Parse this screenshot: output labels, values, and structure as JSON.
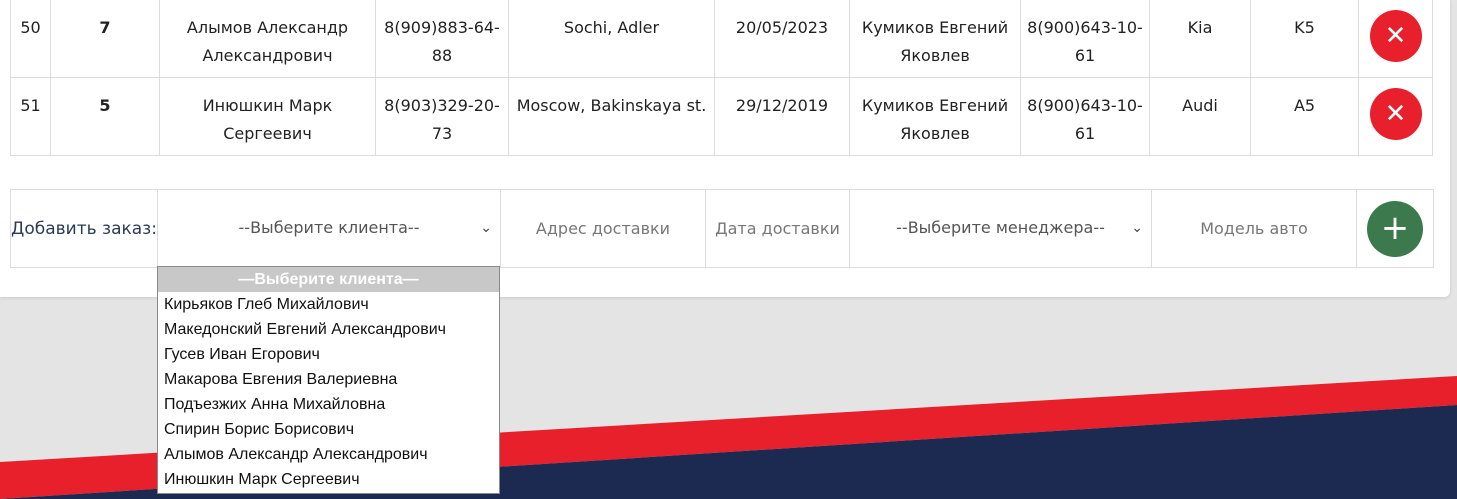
{
  "orders": [
    {
      "id": "50",
      "num": "7",
      "client": "Алымов Александр Александрович",
      "phone": "8(909)883-64-88",
      "address": "Sochi, Adler",
      "date": "20/05/2023",
      "manager": "Кумиков Евгений Яковлев",
      "manager_phone": "8(900)643-10-61",
      "brand": "Kia",
      "model": "K5",
      "delete_icon": "✕"
    },
    {
      "id": "51",
      "num": "5",
      "client": "Инюшкин Марк Сергеевич",
      "phone": "8(903)329-20-73",
      "address": "Moscow, Bakinskaya st.",
      "date": "29/12/2019",
      "manager": "Кумиков Евгений Яковлев",
      "manager_phone": "8(900)643-10-61",
      "brand": "Audi",
      "model": "A5",
      "delete_icon": "✕"
    }
  ],
  "add_form": {
    "label": "Добавить заказ:",
    "client_select": "--Выберите клиента--",
    "address_placeholder": "Адрес доставки",
    "date_placeholder": "Дата доставки",
    "manager_select": "--Выберите менеджера--",
    "model_placeholder": "Модель авто",
    "chevron": "⌄",
    "add_icon": "+"
  },
  "client_dropdown": {
    "selected": "—Выберите клиента—",
    "options": [
      "Кирьяков Глеб Михайлович",
      "Македонский Евгений Александрович",
      "Гусев Иван Егорович",
      "Макарова Евгения Валериевна",
      "Подъезжих Анна Михайловна",
      "Спирин Борис Борисович",
      "Алымов Александр Александрович",
      "Инюшкин Марк Сергеевич"
    ]
  },
  "colors": {
    "delete": "#e8202c",
    "add": "#3c7a4e",
    "stripe_red": "#e8202c",
    "stripe_navy": "#1c2a52"
  }
}
